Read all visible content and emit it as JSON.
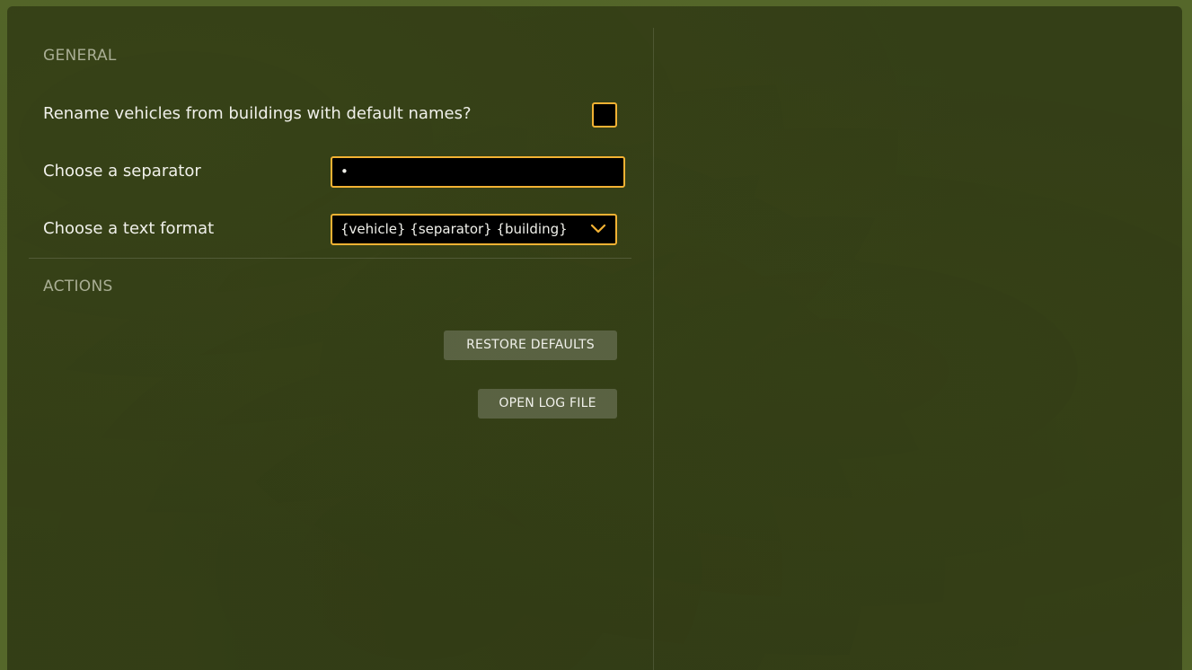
{
  "general": {
    "title": "GENERAL",
    "rename_label": "Rename vehicles from buildings with default names?",
    "rename_checked": false,
    "separator_label": "Choose a separator",
    "separator_value": "•",
    "format_label": "Choose a text format",
    "format_value": "{vehicle} {separator} {building}"
  },
  "actions": {
    "title": "ACTIONS",
    "restore_label": "RESTORE DEFAULTS",
    "open_log_label": "OPEN LOG FILE"
  },
  "colors": {
    "accent": "#f2b233",
    "panel": "#323c16",
    "text": "#f0f0ea",
    "muted": "#a9ae94"
  },
  "icons": {
    "select_arrow": "chevron-down-icon"
  }
}
